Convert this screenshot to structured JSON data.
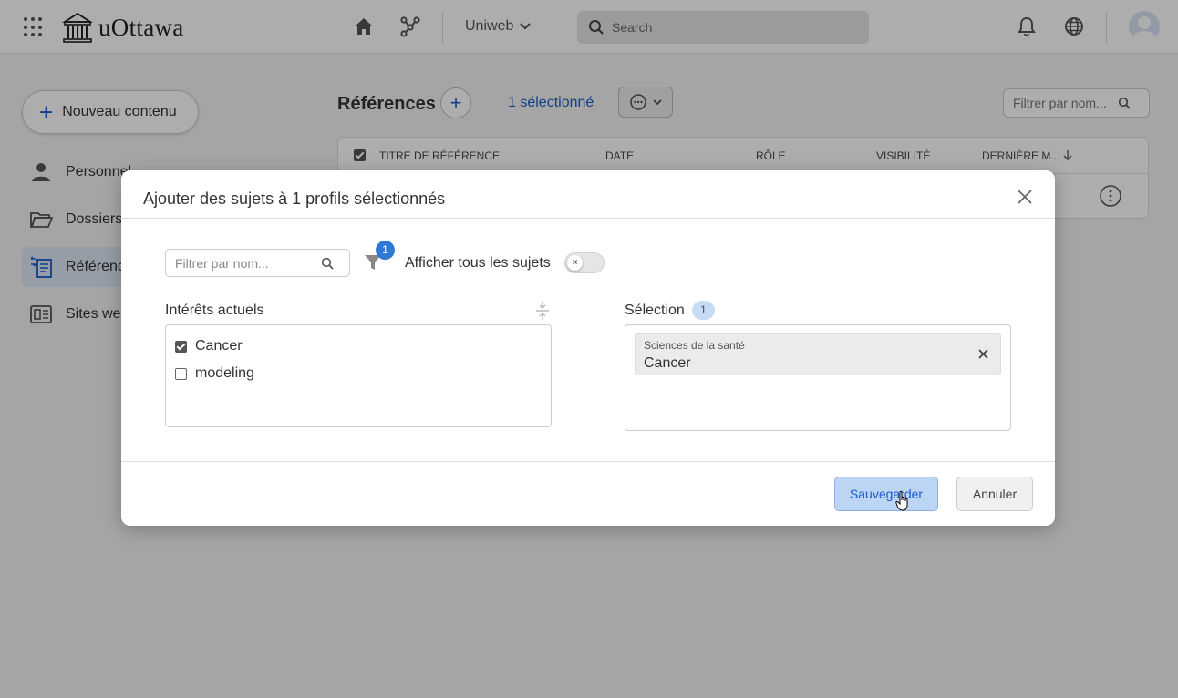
{
  "header": {
    "logo_text": "uOttawa",
    "workspace": "Uniweb",
    "search_placeholder": "Search"
  },
  "sidebar": {
    "new_content_label": "Nouveau contenu",
    "items": [
      {
        "label": "Personnel",
        "icon": "person-icon"
      },
      {
        "label": "Dossiers",
        "icon": "folder-icon"
      },
      {
        "label": "Référenc",
        "icon": "references-icon",
        "active": true
      },
      {
        "label": "Sites web",
        "icon": "website-icon"
      }
    ]
  },
  "content": {
    "title": "Références",
    "selected_text": "1 sélectionné",
    "filter_placeholder": "Filtrer par nom...",
    "columns": [
      "TITRE DE RÉFÉRENCE",
      "DATE",
      "RÔLE",
      "VISIBILITÉ",
      "DERNIÈRE M..."
    ]
  },
  "dialog": {
    "title": "Ajouter des sujets à 1 profils sélectionnés",
    "filter_placeholder": "Filtrer par nom...",
    "filter_badge": "1",
    "show_all_label": "Afficher tous les sujets",
    "show_all_on": false,
    "current_label": "Intérêts actuels",
    "current_items": [
      {
        "label": "Cancer",
        "checked": true
      },
      {
        "label": "modeling",
        "checked": false
      }
    ],
    "selection_label": "Sélection",
    "selection_count": "1",
    "selection_chip": {
      "category": "Sciences de la santé",
      "value": "Cancer"
    },
    "save_label": "Sauvegarder",
    "cancel_label": "Annuler"
  },
  "colors": {
    "accent": "#1a5cc8",
    "badge": "#2f78d6",
    "save_bg": "#bcd5f5"
  }
}
